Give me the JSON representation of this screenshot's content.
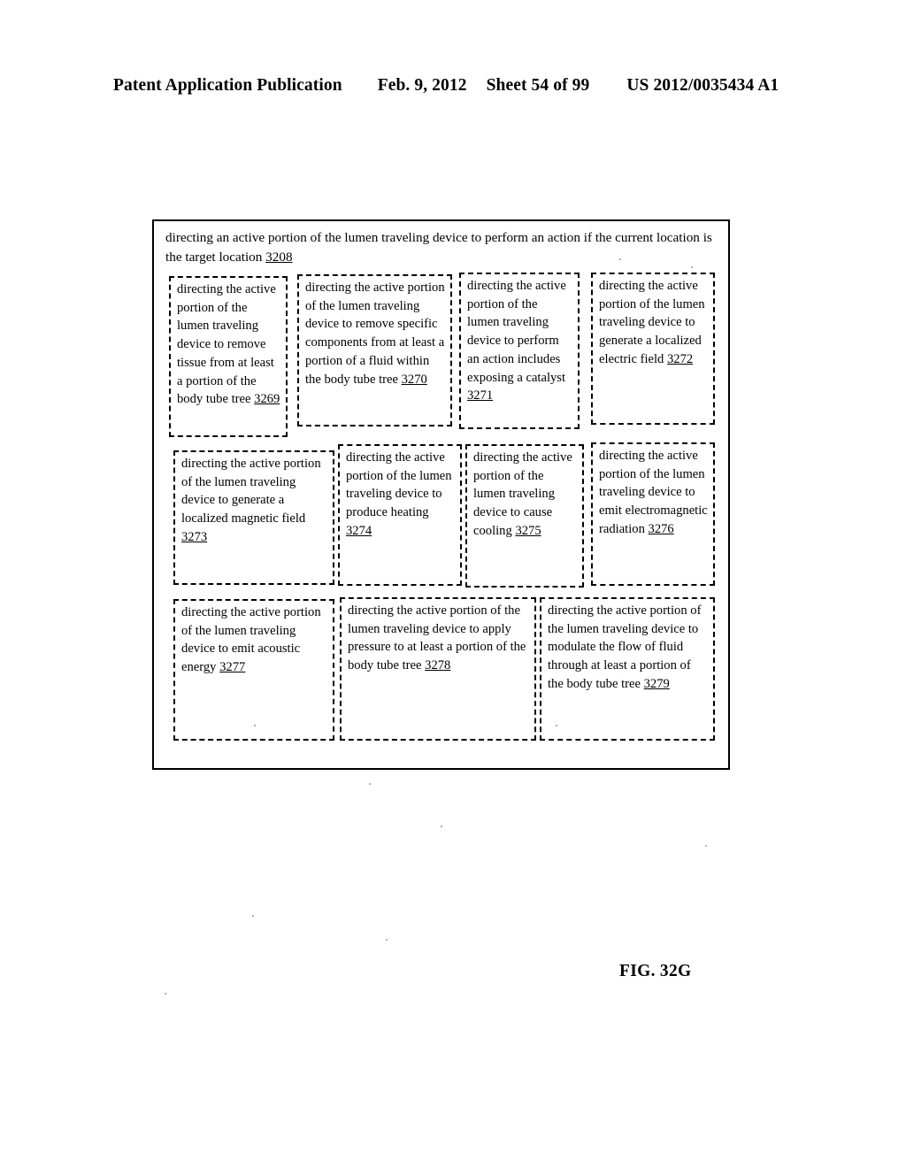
{
  "header": {
    "publication": "Patent Application Publication",
    "date": "Feb. 9, 2012",
    "sheet": "Sheet 54 of 99",
    "patent_number": "US 2012/0035434 A1"
  },
  "figure": {
    "label": "FIG. 32G"
  },
  "flowchart": {
    "title_text": "directing an active portion of the lumen traveling device to perform an action if the current location is the target location ",
    "title_ref": "3208",
    "boxes": [
      {
        "text": "directing the active portion of the lumen traveling device to remove tissue from at least a portion of the body tube tree ",
        "ref": "3269"
      },
      {
        "text": "directing the active portion of the lumen traveling device to remove specific components from at least a portion of a fluid within the body tube tree ",
        "ref": "3270"
      },
      {
        "text": "directing the active portion of the lumen traveling device to perform an action includes exposing a catalyst ",
        "ref": "3271"
      },
      {
        "text": "directing the active portion of the lumen traveling device to generate a localized electric field ",
        "ref": "3272"
      },
      {
        "text": "directing the active portion of the lumen traveling device to generate a localized magnetic field ",
        "ref": "3273"
      },
      {
        "text": "directing the active portion of the lumen traveling device to produce heating ",
        "ref": "3274"
      },
      {
        "text": "directing the active portion of the lumen traveling device to cause cooling ",
        "ref": "3275"
      },
      {
        "text": "directing the active portion of the lumen traveling device to emit electromagnetic radiation ",
        "ref": "3276"
      },
      {
        "text": "directing the active portion of the lumen traveling device to emit acoustic energy ",
        "ref": "3277"
      },
      {
        "text": "directing the active portion of the lumen traveling device to apply pressure to at least a portion of the body tube tree ",
        "ref": "3278"
      },
      {
        "text": "directing the active portion of the lumen traveling device to modulate the flow of fluid through at least a portion of the body tube tree ",
        "ref": "3279"
      }
    ]
  }
}
